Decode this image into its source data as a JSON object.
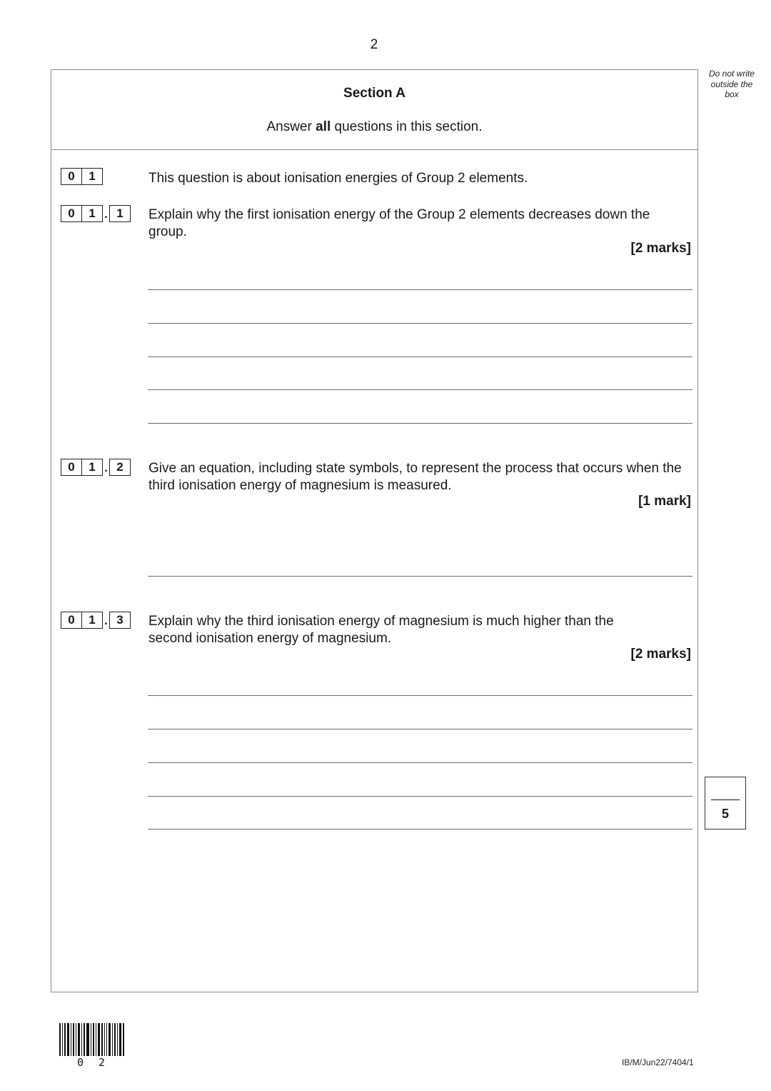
{
  "page": {
    "number": "2",
    "margin_note": "Do not write outside the box"
  },
  "section": {
    "title": "Section A",
    "instruction_before": "Answer ",
    "instruction_bold": "all",
    "instruction_after": " questions in this section."
  },
  "questions": [
    {
      "id": "01",
      "digits": [
        "0",
        "1"
      ],
      "sub": null,
      "text": "This question is about ionisation energies of Group 2 elements.",
      "marks": null,
      "answer_lines": 0
    },
    {
      "id": "01.1",
      "digits": [
        "0",
        "1"
      ],
      "sub": "1",
      "text": "Explain why the first ionisation energy of the Group 2 elements decreases down the group.",
      "marks": "[2 marks]",
      "answer_lines": 5
    },
    {
      "id": "01.2",
      "digits": [
        "0",
        "1"
      ],
      "sub": "2",
      "text": "Give an equation, including state symbols, to represent the process that occurs when the third ionisation energy of magnesium is measured.",
      "marks": "[1 mark]",
      "answer_lines": 1
    },
    {
      "id": "01.3",
      "digits": [
        "0",
        "1"
      ],
      "sub": "3",
      "text": "Explain why the third ionisation energy of magnesium is much higher than the second ionisation energy of magnesium.",
      "marks": "[2 marks]",
      "answer_lines": 5
    }
  ],
  "page_total": {
    "marks": "5"
  },
  "footer": {
    "barcode_number": "0 2",
    "reference": "IB/M/Jun22/7404/1"
  }
}
